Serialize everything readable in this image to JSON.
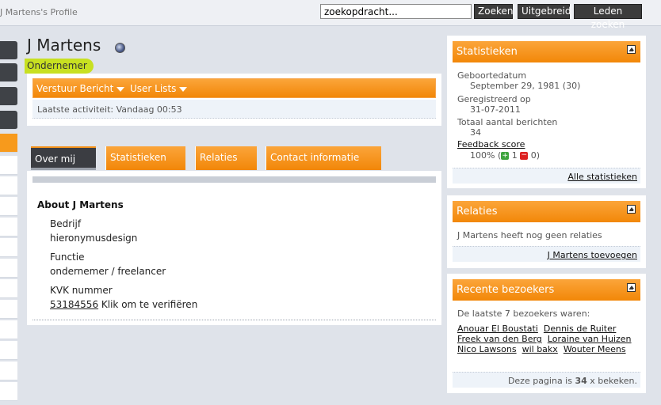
{
  "header": {
    "breadcrumb": "J Martens's Profile",
    "search_value": "zoekopdracht...",
    "btn_search": "Zoeken",
    "btn_advanced": "Uitgebreid",
    "btn_members": "Leden zoeken"
  },
  "profile": {
    "name": "J Martens",
    "usertitle": "Ondernemer",
    "status_icon": "offline-status-icon"
  },
  "actions": {
    "send_message": "Verstuur Bericht",
    "user_lists": "User Lists",
    "last_activity": "Laatste activiteit: Vandaag 00:53"
  },
  "tabs": [
    {
      "label": "Over mij"
    },
    {
      "label": "Statistieken"
    },
    {
      "label": "Relaties"
    },
    {
      "label": "Contact informatie"
    }
  ],
  "about": {
    "title": "About J Martens",
    "fields": [
      {
        "label": "Bedrijf",
        "value": "hieronymusdesign"
      },
      {
        "label": "Functie",
        "value": "ondernemer / freelancer"
      },
      {
        "label": "KVK nummer",
        "value_link": "53184556",
        "value_rest": " Klik om te verifiëren"
      }
    ]
  },
  "stats": {
    "title": "Statistieken",
    "birthdate_label": "Geboortedatum",
    "birthdate_value": "September 29, 1981 (30)",
    "registered_label": "Geregistreerd op",
    "registered_value": "31-07-2011",
    "posts_label": "Totaal aantal berichten",
    "posts_value": "34",
    "feedback_label": "Feedback score",
    "feedback_percent": "100% (",
    "feedback_pos": "1",
    "feedback_neg": "0)",
    "all_stats_link": "Alle statistieken"
  },
  "relations": {
    "title": "Relaties",
    "empty_text": "J Martens heeft nog geen relaties",
    "add_link": "J Martens toevoegen"
  },
  "visitors": {
    "title": "Recente bezoekers",
    "intro": "De laatste 7 bezoekers waren:",
    "names": [
      "Anouar El Boustati",
      "Dennis de Ruiter",
      "Freek van den Berg",
      "Loraine van Huizen",
      "Nico Lawsons",
      "wil bakx",
      "Wouter Meens"
    ],
    "page_views_prefix": "Deze pagina is ",
    "page_views_count": "34",
    "page_views_suffix": " x bekeken."
  },
  "colors": {
    "accent_orange": "#f28708",
    "usertitle_bg": "#c8e021",
    "dark_button": "#3c3c3c"
  }
}
